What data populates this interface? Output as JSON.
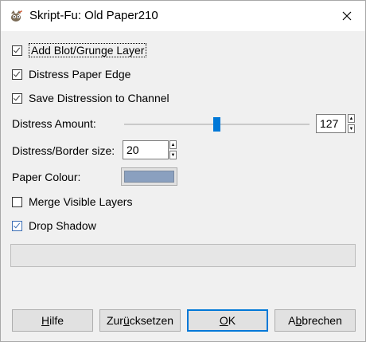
{
  "window": {
    "title": "Skript-Fu: Old Paper210"
  },
  "options": {
    "add_blot": {
      "label": "Add Blot/Grunge Layer",
      "checked": true
    },
    "distress_edge": {
      "label": "Distress Paper Edge",
      "checked": true
    },
    "save_distression": {
      "label": "Save Distression to Channel",
      "checked": true
    },
    "merge_visible": {
      "label": "Merge Visible Layers",
      "checked": false
    },
    "drop_shadow": {
      "label": "Drop Shadow",
      "checked": true
    }
  },
  "distress_amount": {
    "label": "Distress Amount:",
    "value": "127",
    "min": 0,
    "max": 255
  },
  "border_size": {
    "label": "Distress/Border size:",
    "value": "20"
  },
  "paper_colour": {
    "label": "Paper Colour:",
    "color": "#8aa0bf"
  },
  "progress": {
    "fraction": 0
  },
  "buttons": {
    "help": {
      "pre": "",
      "u": "H",
      "post": "ilfe"
    },
    "reset": {
      "pre": "Zur",
      "u": "ü",
      "post": "cksetzen"
    },
    "ok": {
      "pre": "",
      "u": "O",
      "post": "K"
    },
    "cancel": {
      "pre": "A",
      "u": "b",
      "post": "brechen"
    }
  },
  "colors": {
    "accent": "#0078d7",
    "checkbox_blue": "#3d6fb5"
  },
  "icons": {
    "app": "gimp-wilber-icon",
    "close": "close-icon"
  }
}
